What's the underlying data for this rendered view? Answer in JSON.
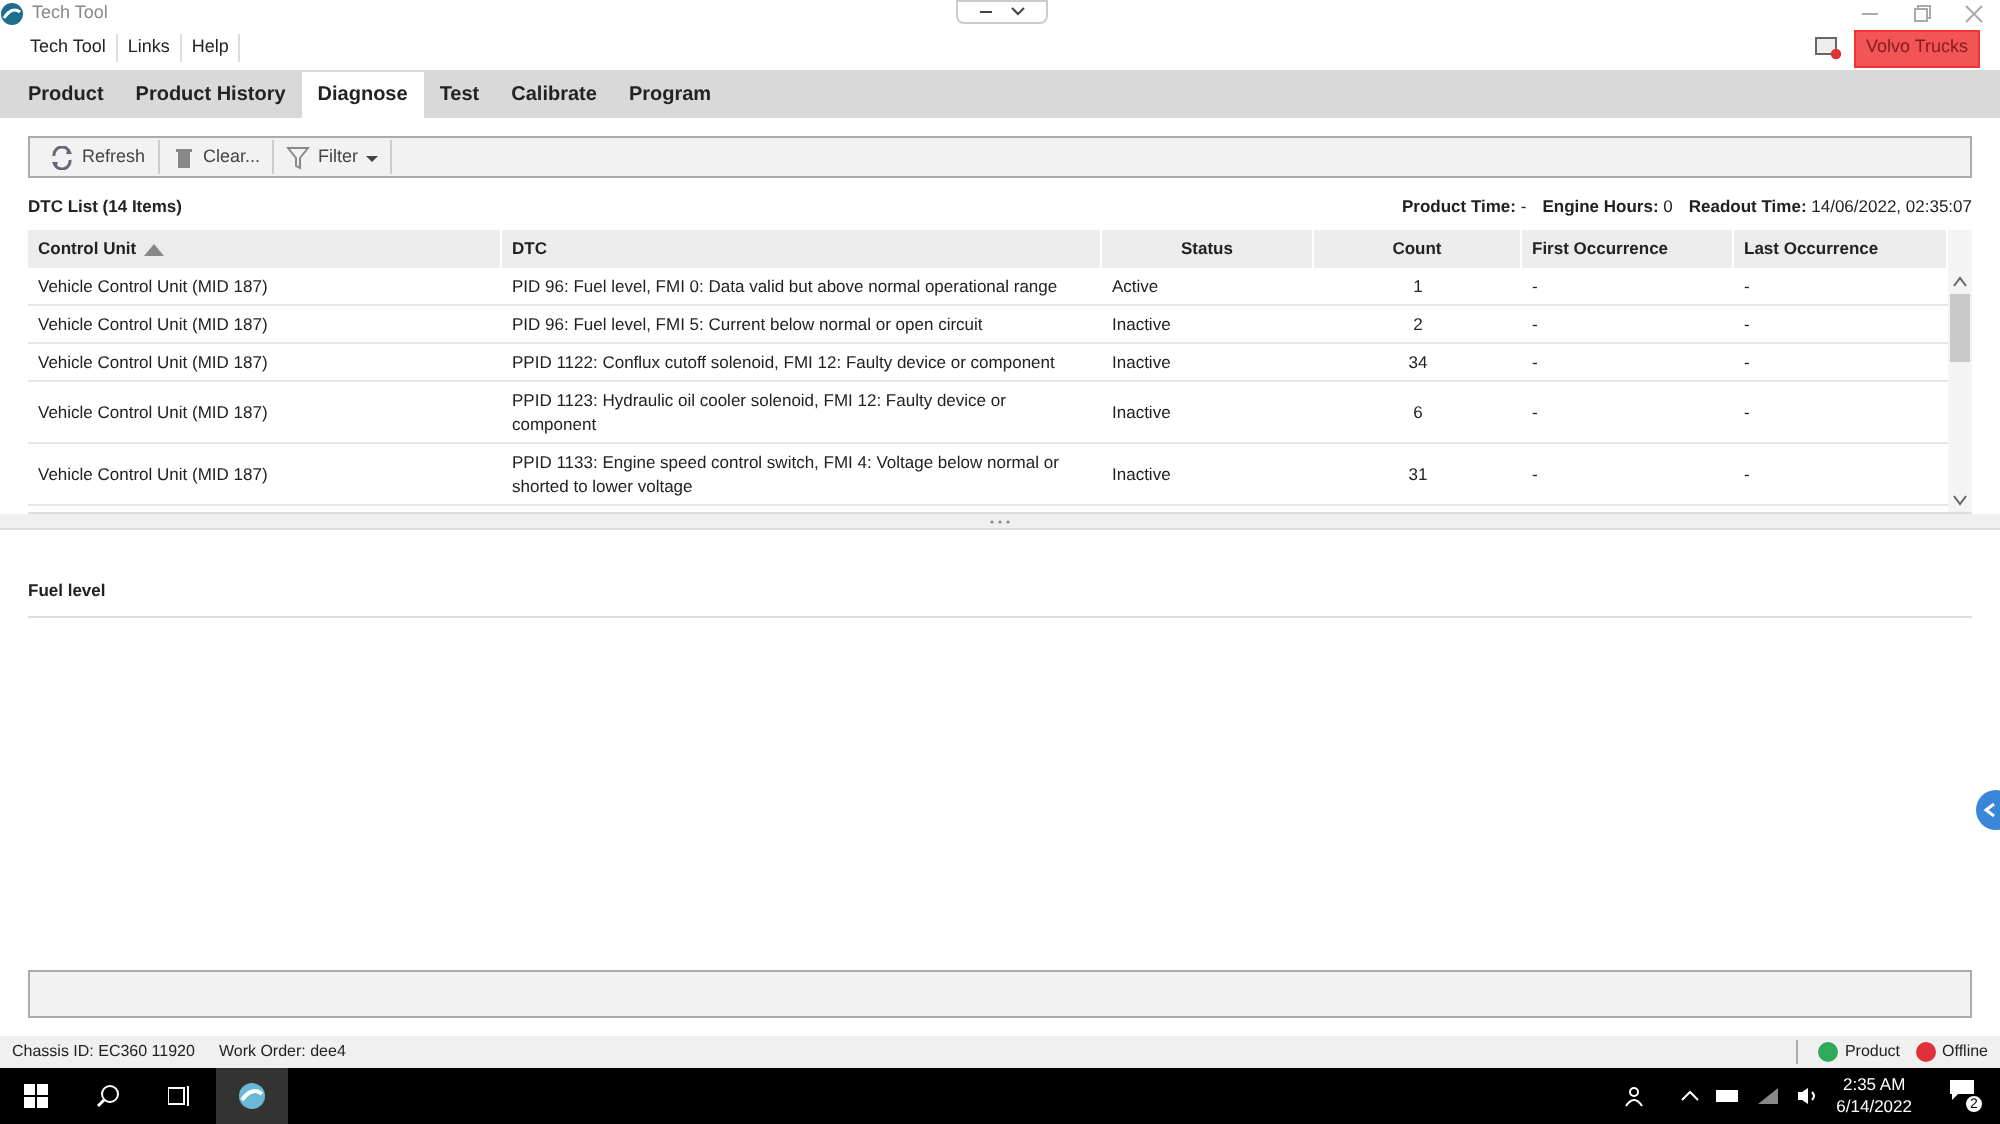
{
  "window": {
    "title": "Tech Tool"
  },
  "menu": [
    "Tech Tool",
    "Links",
    "Help"
  ],
  "brand_button": "Volvo Trucks",
  "tabs": [
    {
      "label": "Product",
      "selected": false
    },
    {
      "label": "Product History",
      "selected": false
    },
    {
      "label": "Diagnose",
      "selected": true
    },
    {
      "label": "Test",
      "selected": false
    },
    {
      "label": "Calibrate",
      "selected": false
    },
    {
      "label": "Program",
      "selected": false
    }
  ],
  "toolbar": [
    {
      "kind": "refresh",
      "label": "Refresh"
    },
    {
      "kind": "clear",
      "label": "Clear..."
    },
    {
      "kind": "filter",
      "label": "Filter"
    }
  ],
  "dtc_list": {
    "title": "DTC List (14 Items)",
    "info": [
      {
        "label": "Product Time:",
        "value": "-"
      },
      {
        "label": "Engine Hours:",
        "value": "0"
      },
      {
        "label": "Readout Time:",
        "value": "14/06/2022, 02:35:07"
      }
    ],
    "columns": [
      "Control Unit",
      "DTC",
      "Status",
      "Count",
      "First Occurrence",
      "Last Occurrence"
    ],
    "rows": [
      [
        "Vehicle Control Unit (MID 187)",
        "PID 96: Fuel level, FMI 0: Data valid but above normal operational range",
        "Active",
        "1",
        "-",
        "-"
      ],
      [
        "Vehicle Control Unit (MID 187)",
        "PID 96: Fuel level, FMI 5: Current below normal or open circuit",
        "Inactive",
        "2",
        "-",
        "-"
      ],
      [
        "Vehicle Control Unit (MID 187)",
        "PPID 1122: Conflux cutoff solenoid, FMI 12: Faulty device or component",
        "Inactive",
        "34",
        "-",
        "-"
      ],
      [
        "Vehicle Control Unit (MID 187)",
        "PPID 1123: Hydraulic oil cooler solenoid, FMI 12: Faulty device or component",
        "Inactive",
        "6",
        "-",
        "-"
      ],
      [
        "Vehicle Control Unit (MID 187)",
        "PPID 1133: Engine speed control switch, FMI 4: Voltage below normal or shorted to lower voltage",
        "Inactive",
        "31",
        "-",
        "-"
      ]
    ]
  },
  "detail": {
    "title": "Fuel level"
  },
  "status_bar": {
    "left": [
      "Chassis ID: EC360 11920",
      "Work Order: dee4"
    ],
    "indicators": [
      {
        "label": "Product",
        "color": "#2eaa5c"
      },
      {
        "label": "Offline",
        "color": "#e0303a"
      }
    ]
  },
  "taskbar": {
    "time": "2:35 AM",
    "date": "6/14/2022",
    "notifications": "2"
  }
}
